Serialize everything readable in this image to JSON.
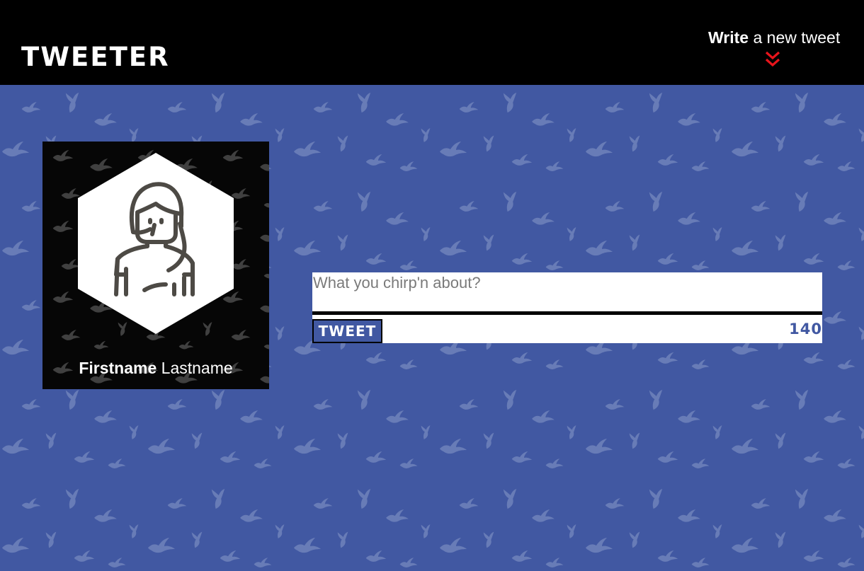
{
  "header": {
    "brand": "Tweeter",
    "compose_toggle": {
      "bold": "Write",
      "rest": "a new tweet",
      "icon": "double-chevron-down-icon"
    }
  },
  "profile": {
    "avatar_icon": "user-avatar-icon",
    "first_name": "Firstname",
    "last_name": "Lastname"
  },
  "composer": {
    "placeholder": "What you chirp'n about?",
    "value": "",
    "button_label": "Tweet",
    "char_counter": "140"
  },
  "colors": {
    "page_background": "#4158a2",
    "header_background": "#000000",
    "accent_red": "#e8141b",
    "card_background": "#060606",
    "counter": "#4158a2"
  }
}
